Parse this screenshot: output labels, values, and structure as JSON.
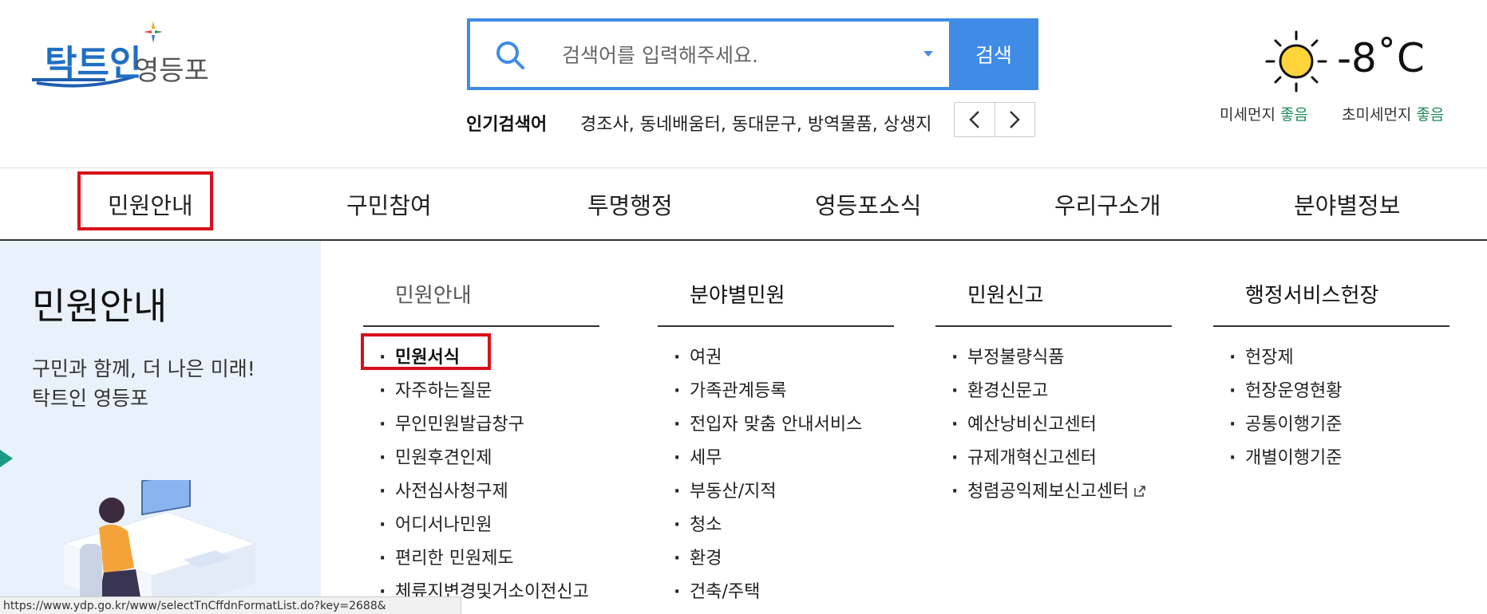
{
  "logo": {
    "primary": "탁트인",
    "secondary": "영등포"
  },
  "search": {
    "placeholder": "검색어를 입력해주세요.",
    "button": "검색"
  },
  "popular": {
    "label": "인기검색어",
    "terms": "경조사, 동네배움터, 동대문구, 방역물품, 상생지"
  },
  "weather": {
    "temp": "-8˚C",
    "dust_label": "미세먼지",
    "dust_value": "좋음",
    "fine_dust_label": "초미세먼지",
    "fine_dust_value": "좋음"
  },
  "gnb": [
    "민원안내",
    "구민참여",
    "투명행정",
    "영등포소식",
    "우리구소개",
    "분야별정보"
  ],
  "mega": {
    "title": "민원안내",
    "desc_line1": "구민과 함께, 더 나은 미래!",
    "desc_line2": "탁트인 영등포",
    "columns": [
      {
        "heading": "민원안내",
        "items": [
          "민원서식",
          "자주하는질문",
          "무인민원발급창구",
          "민원후견인제",
          "사전심사청구제",
          "어디서나민원",
          "편리한 민원제도",
          "체류지변경및거소이전신고"
        ]
      },
      {
        "heading": "분야별민원",
        "items": [
          "여권",
          "가족관계등록",
          "전입자 맞춤 안내서비스",
          "세무",
          "부동산/지적",
          "청소",
          "환경",
          "건축/주택"
        ]
      },
      {
        "heading": "민원신고",
        "items": [
          "부정불량식품",
          "환경신문고",
          "예산낭비신고센터",
          "규제개혁신고센터",
          "청렴공익제보신고센터"
        ]
      },
      {
        "heading": "행정서비스헌장",
        "items": [
          "헌장제",
          "헌장운영현황",
          "공통이행기준",
          "개별이행기준"
        ]
      }
    ]
  },
  "status_bar": {
    "url": "https://www.ydp.go.kr/www/selectTnCffdnFormatList.do?key=2688&"
  },
  "colors": {
    "accent": "#3f8be6",
    "highlight": "#d8101a",
    "good": "#1e8a5a",
    "panel": "#e9f1fb"
  }
}
